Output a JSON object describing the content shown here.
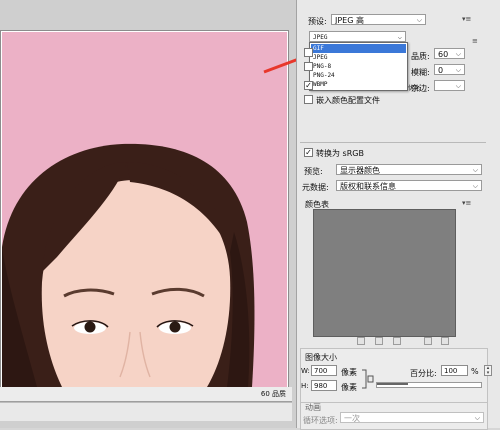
{
  "preview": {
    "quality_readout": "60 品质"
  },
  "panel": {
    "preset_label": "预设:",
    "preset_value": "JPEG 高",
    "format_value": "JPEG",
    "format_options": [
      "GIF",
      "JPEG",
      "PNG-8",
      "PNG-24",
      "WBMP"
    ],
    "format_highlighted": "GIF",
    "quality_label": "品质:",
    "quality_value": "60",
    "blur_label": "模糊:",
    "blur_value": "0",
    "matte_label": "杂边:",
    "optimized_partial": "优化",
    "embed_profile_label": "嵌入颜色配置文件",
    "convert_srgb_label": "转换为 sRGB",
    "preview_label": "预览:",
    "preview_value": "显示器颜色",
    "metadata_label": "元数据:",
    "metadata_value": "版权和联系信息",
    "color_table_label": "颜色表",
    "image_size_label": "图像大小",
    "width_prefix": "W:",
    "width_value": "700",
    "height_prefix": "H:",
    "height_value": "980",
    "pixels_unit": "像素",
    "percent_label": "百分比:",
    "percent_value": "100",
    "percent_unit": "%",
    "animation_label": "动画",
    "loop_label": "循环选项:",
    "loop_value": "一次"
  },
  "colors": {
    "photo_bg": "#ecb1c6",
    "annotation_arrow": "#e8372b",
    "highlight": "#3b78d8"
  }
}
